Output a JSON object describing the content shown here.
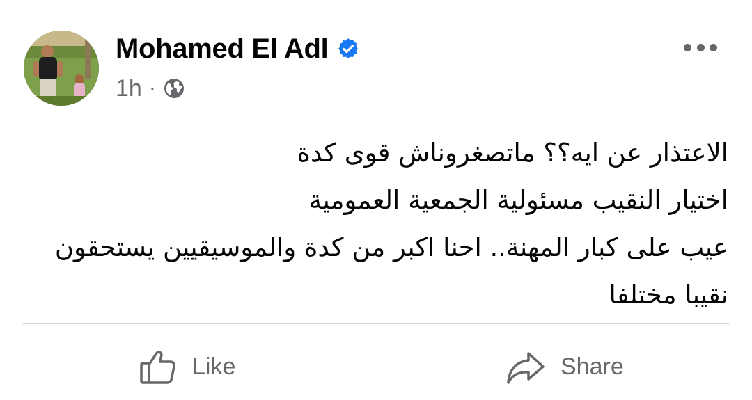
{
  "author": {
    "name": "Mohamed El Adl",
    "verified": true,
    "verified_color": "#1877f2",
    "avatar_icon": "profile-photo"
  },
  "meta": {
    "time": "1h",
    "separator": "·",
    "audience_icon": "globe-icon"
  },
  "menu": {
    "icon": "more-horizontal-icon"
  },
  "post": {
    "lines": [
      "الاعتذار عن ايه؟؟ ماتصغروناش قوى كدة",
      "اختيار النقيب مسئولية الجمعية العمومية",
      "عيب على كبار المهنة.. احنا اكبر من كدة والموسيقيين يستحقون",
      "نقيبا مختلفا"
    ]
  },
  "actions": {
    "like_label": "Like",
    "like_icon": "thumbs-up-icon",
    "share_label": "Share",
    "share_icon": "share-arrow-icon"
  },
  "colors": {
    "text_primary": "#050505",
    "text_secondary": "#65676b",
    "divider": "#ced0d4",
    "brand_blue": "#1877f2"
  }
}
